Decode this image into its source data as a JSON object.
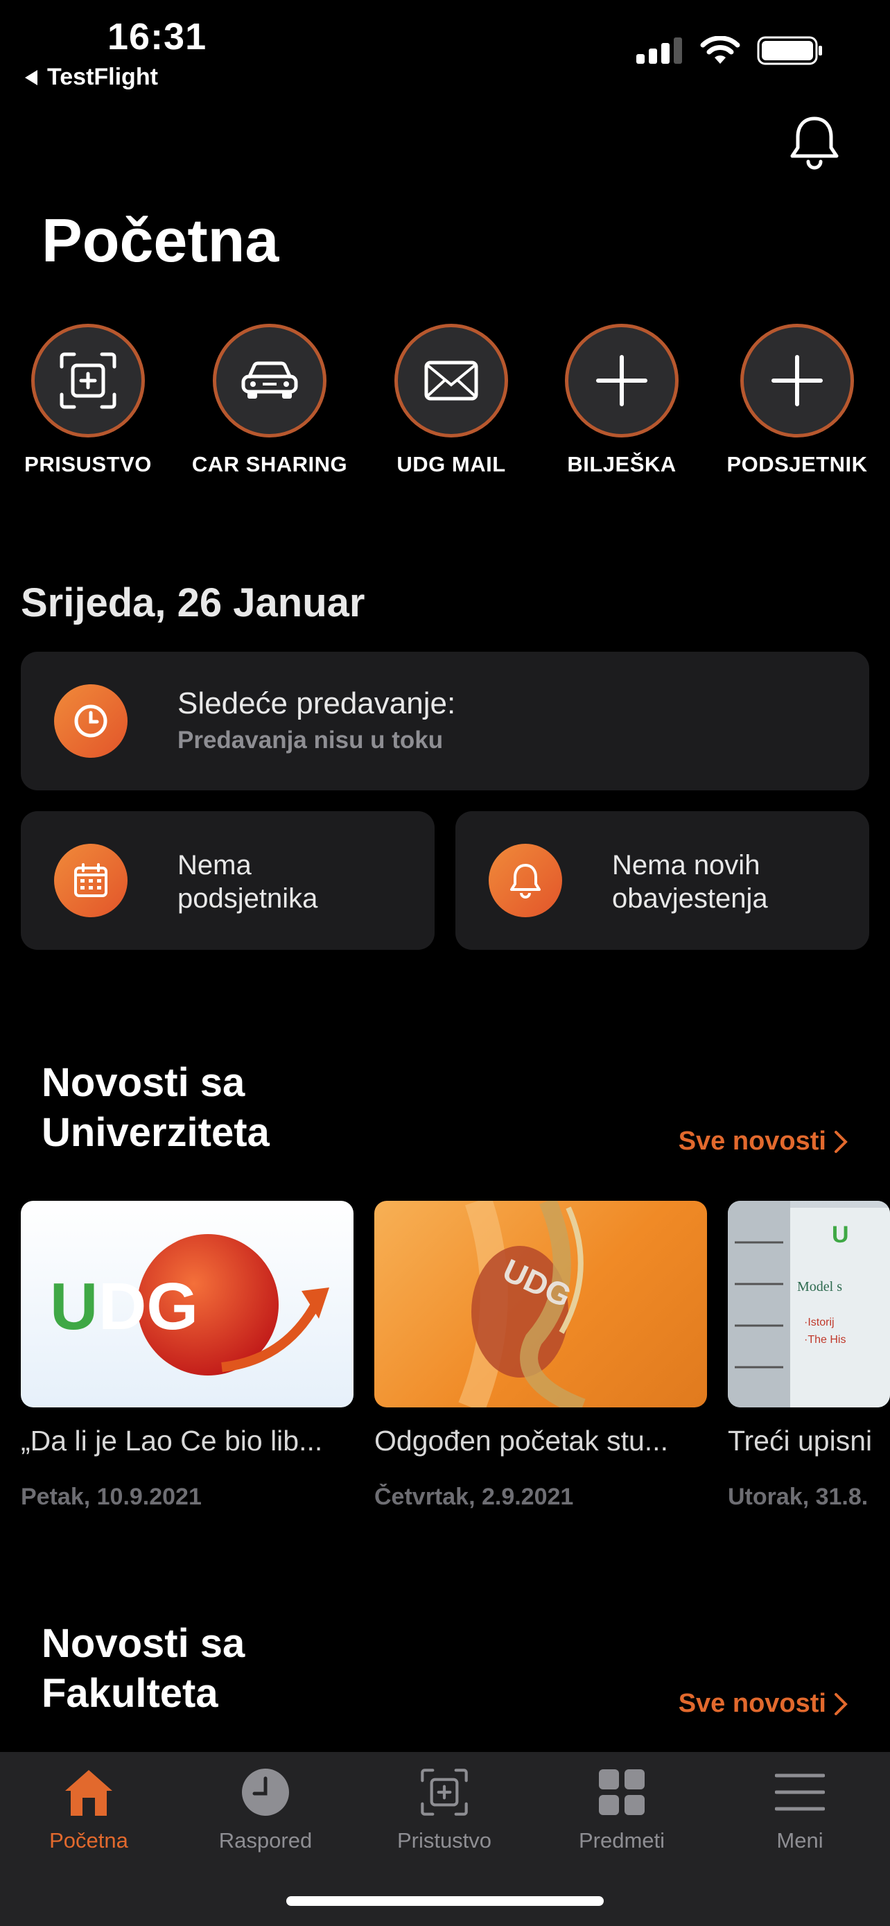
{
  "status_bar": {
    "time": "16:31",
    "back_label": "TestFlight"
  },
  "header": {
    "title": "Početna",
    "bell_icon": "bell-icon"
  },
  "quick_actions": [
    {
      "label": "PRISUSTVO",
      "icon": "attendance-icon"
    },
    {
      "label": "CAR SHARING",
      "icon": "car-icon"
    },
    {
      "label": "UDG MAIL",
      "icon": "mail-icon"
    },
    {
      "label": "BILJEŠKA",
      "icon": "plus-icon"
    },
    {
      "label": "PODSJETNIK",
      "icon": "plus-icon"
    }
  ],
  "today": {
    "date": "Srijeda, 26 Januar",
    "next_lecture_label": "Sledeće predavanje:",
    "next_lecture_value": "Predavanja nisu u toku",
    "reminders_text": "Nema podsjetnika",
    "notifications_text": "Nema novih obavjestenja"
  },
  "university_news": {
    "title": "Novosti sa Univerziteta",
    "see_all": "Sve novosti",
    "items": [
      {
        "title": "„Da li je Lao Ce bio lib...",
        "date": "Petak, 10.9.2021"
      },
      {
        "title": "Odgođen početak stu...",
        "date": "Četvrtak, 2.9.2021"
      },
      {
        "title": "Treći upisni",
        "date": "Utorak, 31.8."
      }
    ]
  },
  "faculty_news": {
    "title": "Novosti sa Fakulteta",
    "see_all": "Sve novosti"
  },
  "tabbar": {
    "items": [
      {
        "label": "Početna",
        "icon": "home-icon",
        "active": true
      },
      {
        "label": "Raspored",
        "icon": "clock-icon",
        "active": false
      },
      {
        "label": "Pristustvo",
        "icon": "attendance-icon",
        "active": false
      },
      {
        "label": "Predmeti",
        "icon": "grid-icon",
        "active": false
      },
      {
        "label": "Meni",
        "icon": "menu-icon",
        "active": false
      }
    ]
  },
  "colors": {
    "accent": "#e2692d",
    "background": "#000000",
    "card": "#1c1c1e",
    "tabbar": "#232325"
  }
}
